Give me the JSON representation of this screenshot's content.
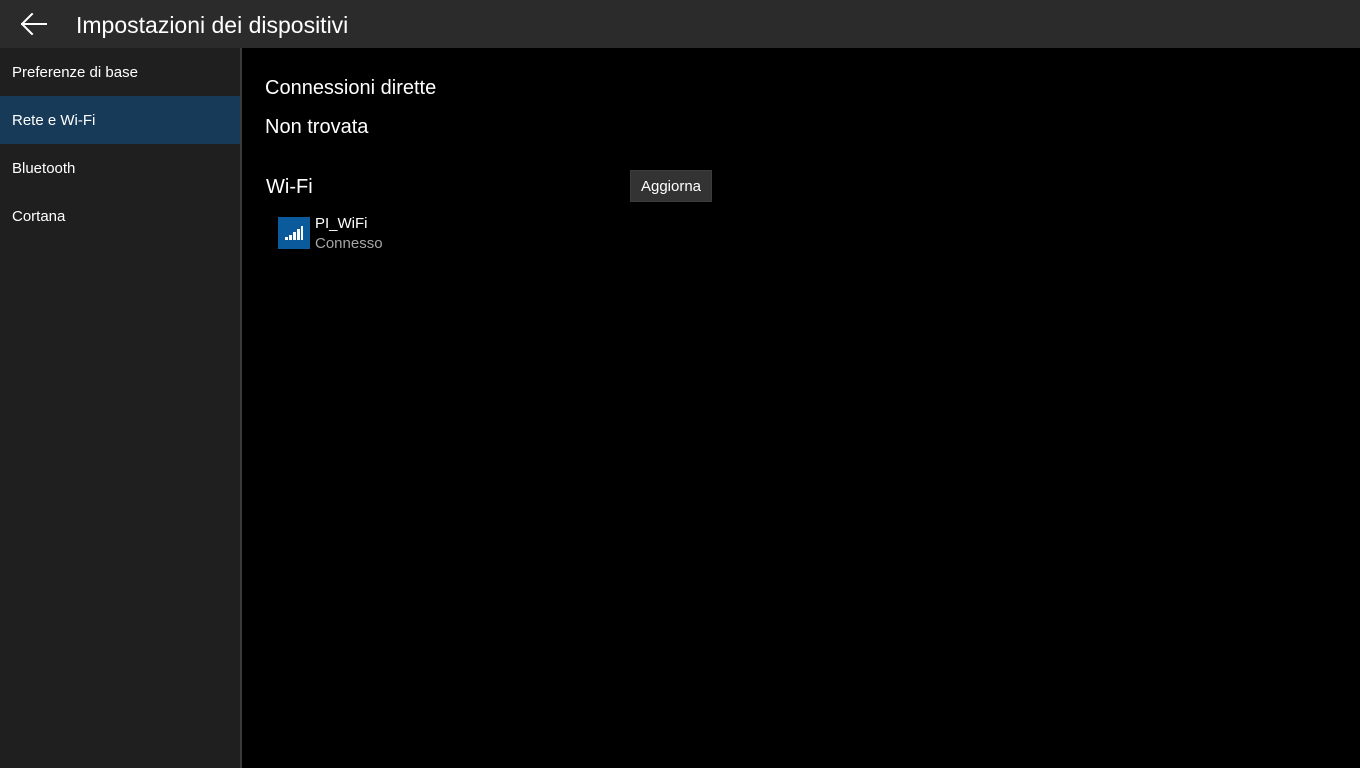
{
  "header": {
    "title": "Impostazioni dei dispositivi",
    "back_icon": "back-arrow-icon"
  },
  "sidebar": {
    "items": [
      {
        "label": "Preferenze di base",
        "selected": false
      },
      {
        "label": "Rete e Wi-Fi",
        "selected": true
      },
      {
        "label": "Bluetooth",
        "selected": false
      },
      {
        "label": "Cortana",
        "selected": false
      }
    ]
  },
  "main": {
    "direct_connections": {
      "title": "Connessioni dirette",
      "status": "Non trovata"
    },
    "wifi": {
      "title": "Wi-Fi",
      "refresh_label": "Aggiorna",
      "networks": [
        {
          "name": "PI_WiFi",
          "status": "Connesso",
          "icon": "wifi-signal-icon"
        }
      ]
    }
  },
  "colors": {
    "titlebar_bg": "#2b2b2b",
    "sidebar_bg": "#1f1f1f",
    "selected_bg": "#173a59",
    "main_bg": "#000000",
    "accent": "#0a5a9c",
    "secondary_text": "#a6a6a6"
  }
}
